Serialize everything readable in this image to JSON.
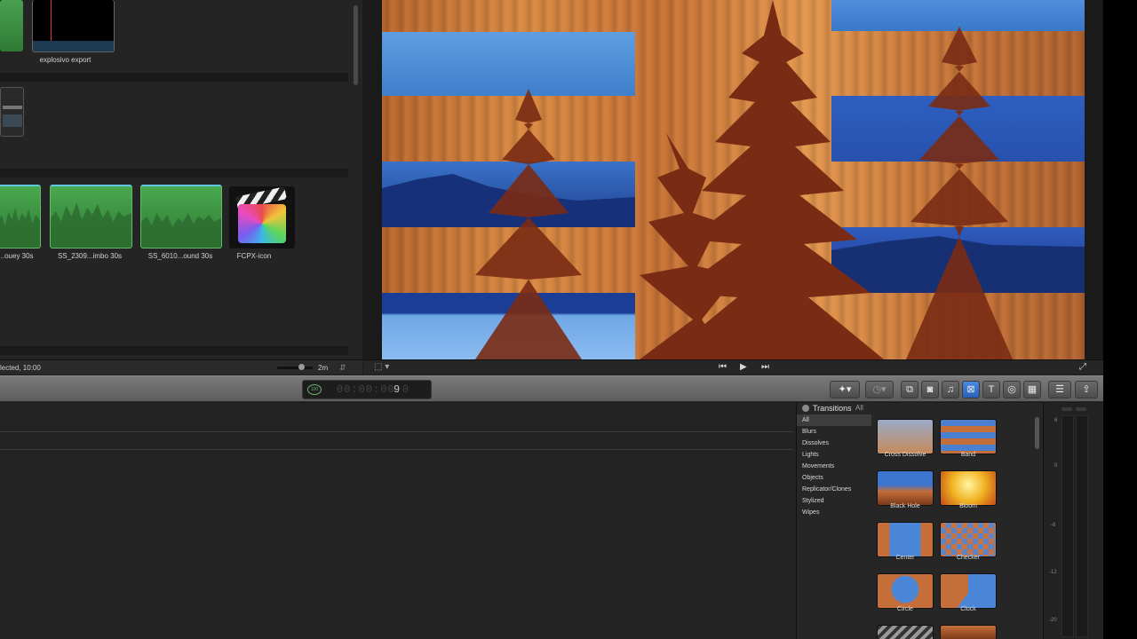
{
  "browser": {
    "clip_top_label": "explosivo export",
    "clips": [
      {
        "label": "...ouey 30s",
        "kind": "audio"
      },
      {
        "label": "SS_2309...imbo 30s",
        "kind": "audio"
      },
      {
        "label": "SS_6010...ound 30s",
        "kind": "audio"
      },
      {
        "label": "FCPX-icon",
        "kind": "image"
      }
    ],
    "status": "lected, 10:00",
    "zoom_label": "2m"
  },
  "viewer": {
    "transport": {
      "prev": "⏮",
      "play": "▶",
      "next": "⏭"
    }
  },
  "toolbar": {
    "timecode_digits": "00:00:00:0",
    "timecode_frame": "9",
    "timecode_badge": "100"
  },
  "transitions": {
    "title": "Transitions",
    "scope": "All",
    "categories": [
      "All",
      "Blurs",
      "Dissolves",
      "Lights",
      "Movements",
      "Objects",
      "Replicator/Clones",
      "Stylized",
      "Wipes"
    ],
    "selected_category": "All",
    "items": [
      "Cross Dissolve",
      "Band",
      "Black Hole",
      "Bloom",
      "Center",
      "Checker",
      "Circle",
      "Clock"
    ]
  },
  "meters": {
    "ticks": [
      "6",
      "0",
      "-6",
      "-12",
      "-20"
    ]
  }
}
